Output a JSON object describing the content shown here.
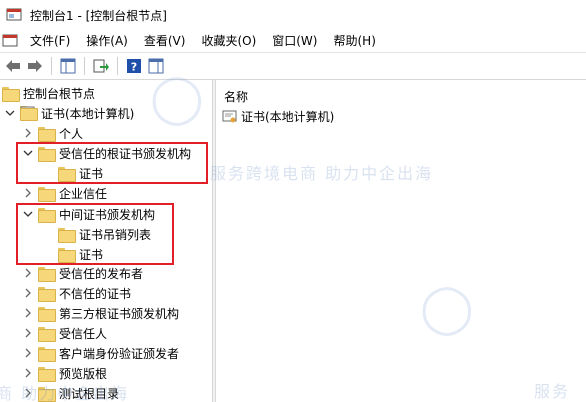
{
  "window": {
    "title": "控制台1 - [控制台根节点]"
  },
  "menu": {
    "items": [
      "文件(F)",
      "操作(A)",
      "查看(V)",
      "收藏夹(O)",
      "窗口(W)",
      "帮助(H)"
    ]
  },
  "toolbar": {
    "icons": [
      "back-arrow-icon",
      "forward-arrow-icon",
      "show-hide-tree-icon",
      "export-list-icon",
      "help-icon",
      "action-pane-icon"
    ]
  },
  "tree": {
    "root": "控制台根节点",
    "store": "证书(本地计算机)",
    "personal": "个人",
    "trusted_root": "受信任的根证书颁发机构",
    "trusted_root_certs": "证书",
    "enterprise_trust": "企业信任",
    "intermediate": "中间证书颁发机构",
    "intermediate_crl": "证书吊销列表",
    "intermediate_certs": "证书",
    "trusted_publishers": "受信任的发布者",
    "untrusted": "不信任的证书",
    "third_party_root": "第三方根证书颁发机构",
    "trusted_people": "受信任人",
    "client_auth": "客户端身份验证颁发者",
    "preview_build": "预览版根",
    "test_roots": "测试根目录"
  },
  "list": {
    "column_name": "名称",
    "items": [
      "证书(本地计算机)"
    ]
  },
  "watermark": {
    "line1": "服务跨境电商 助力中企出海",
    "fragment_left": "商 助力中企出海",
    "fragment_right": "服务"
  },
  "colors": {
    "highlight": "#e21f26",
    "folder": "#f6d77a"
  }
}
